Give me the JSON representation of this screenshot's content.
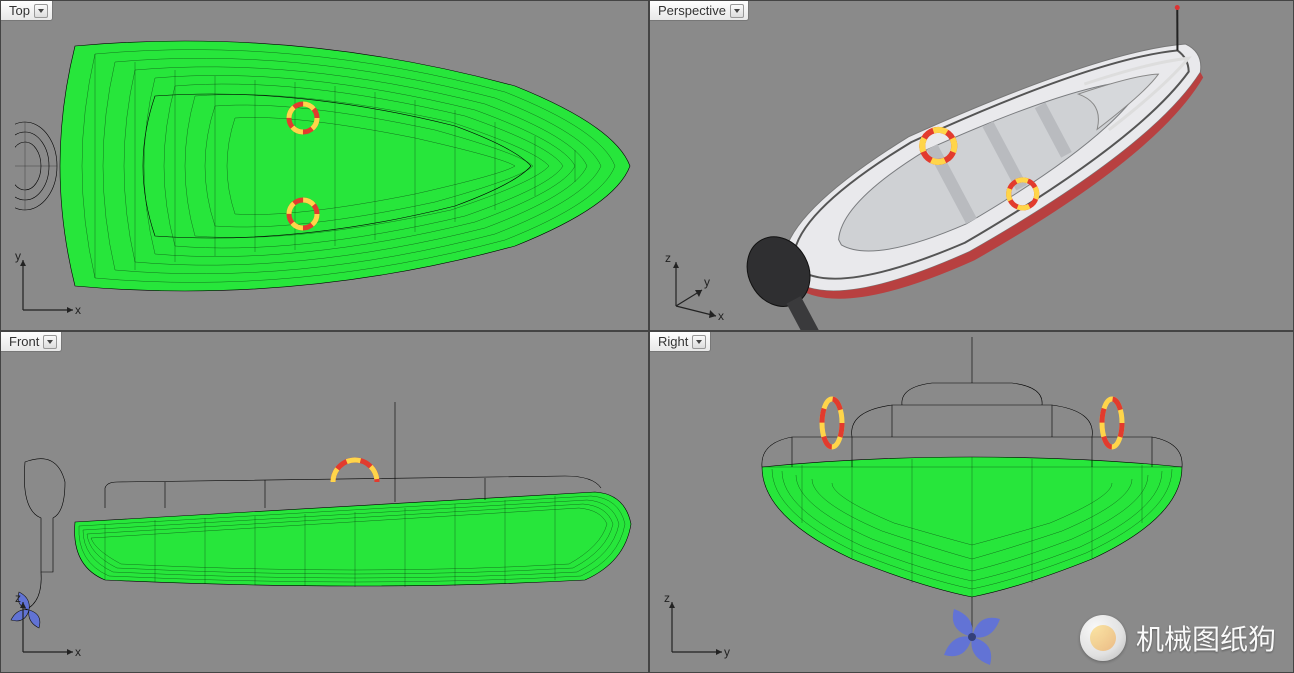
{
  "viewports": {
    "top": {
      "label": "Top",
      "axes": [
        "x",
        "y"
      ]
    },
    "perspective": {
      "label": "Perspective",
      "axes": [
        "x",
        "y",
        "z"
      ]
    },
    "front": {
      "label": "Front",
      "axes": [
        "x",
        "z"
      ]
    },
    "right": {
      "label": "Right",
      "axes": [
        "y",
        "z"
      ]
    }
  },
  "icons": {
    "dropdown": "chevron-down-icon"
  },
  "model": {
    "name": "motor-boat",
    "display_modes": {
      "top": "wireframe",
      "perspective": "shaded",
      "front": "wireframe",
      "right": "wireframe"
    },
    "colors": {
      "hull_surface": "#27e63b",
      "wireframe": "#000000",
      "accent_ring": "#ffd54a",
      "accent_ring2": "#e23b2e",
      "propeller": "#5b6fe2",
      "shaded_hull": "#e8e8ea",
      "shaded_deck": "#9ca0a4",
      "motor": "#2f2f31"
    }
  },
  "watermark": {
    "text": "机械图纸狗",
    "avatar_alt": "wechat-avatar"
  }
}
